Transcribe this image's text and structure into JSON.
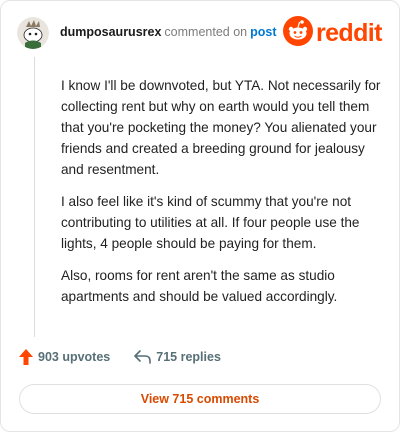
{
  "comment": {
    "username": "dumposaurusrex",
    "commented_text": "commented on",
    "post_link": "post",
    "avatar_icon": "snoo-avatar-icon",
    "paragraphs": [
      "I know I'll be downvoted, but YTA. Not necessarily for collecting rent but why on earth would you tell them that you're pocketing the money? You alienated your friends and created a breeding ground for jealousy and resentment.",
      "I also feel like it's kind of scummy that you're not contributing to utilities at all. If four people use the lights, 4 people should be paying for them.",
      "Also, rooms for rent aren't the same as studio apartments and should be valued accordingly."
    ]
  },
  "brand": {
    "name": "reddit",
    "icon": "reddit-snoo-icon",
    "color": "#ff4500"
  },
  "stats": {
    "upvotes_label": "903 upvotes",
    "upvote_icon": "upvote-arrow-icon",
    "replies_label": "715 replies",
    "reply_icon": "reply-arrow-icon"
  },
  "actions": {
    "view_comments_label": "View 715 comments"
  },
  "colors": {
    "accent": "#ff4500",
    "link": "#0079d3",
    "muted": "#576f76"
  }
}
